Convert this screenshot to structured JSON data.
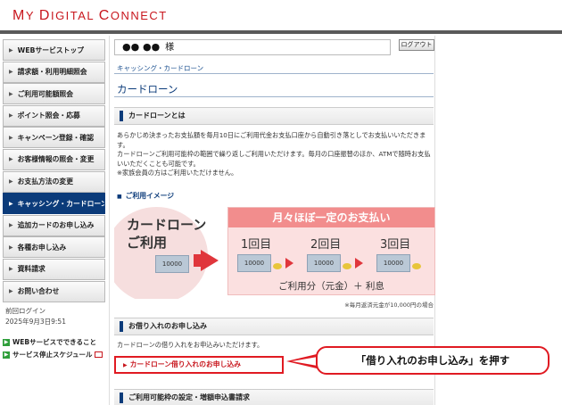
{
  "logo": {
    "text_a": "M",
    "text_b": "Y ",
    "text_c": "D",
    "text_d": "IGITAL ",
    "text_e": "C",
    "text_f": "ONNECT"
  },
  "header": {
    "greeting_name": "●● ●●",
    "greeting_suffix": "様",
    "logout": "ログアウト"
  },
  "sidebar": {
    "items": [
      {
        "label": "WEBサービストップ",
        "active": false
      },
      {
        "label": "請求額・利用明細照会",
        "active": false
      },
      {
        "label": "ご利用可能額照会",
        "active": false
      },
      {
        "label": "ポイント照会・応募",
        "active": false
      },
      {
        "label": "キャンペーン登録・確認",
        "active": false
      },
      {
        "label": "お客様情報の照会・変更",
        "active": false
      },
      {
        "label": "お支払方法の変更",
        "active": false
      },
      {
        "label": "キャッシング・カードローン",
        "active": true
      },
      {
        "label": "追加カードのお申し込み",
        "active": false
      },
      {
        "label": "各種お申し込み",
        "active": false
      },
      {
        "label": "資料請求",
        "active": false
      },
      {
        "label": "お問い合わせ",
        "active": false
      }
    ],
    "last_login_label": "前回ログイン",
    "last_login_value": "2025年9月3日9:51",
    "links": [
      {
        "label": "WEBサービスでできること"
      },
      {
        "label": "サービス停止スケジュール"
      }
    ]
  },
  "main": {
    "breadcrumb": "キャッシング・カードローン",
    "title": "カードローン",
    "section1_title": "カードローンとは",
    "section1_text_1": "あらかじめ決まったお支払額を毎月10日にご利用代金お支払口座から自動引き落としでお支払いいただきます。",
    "section1_text_2": "カードローンご利用可能枠の範囲で繰り返しご利用いただけます。毎月の口座振替のほか、ATMで随時お支払いいただくことも可能です。",
    "section1_text_3": "※家族会員の方はご利用いただけません。",
    "image_heading": "ご利用イメージ",
    "illus": {
      "left_line1": "カードローン",
      "left_line2": "ご利用",
      "panel_title": "月々ほぼ一定のお支払い",
      "period1": "1回目",
      "period2": "2回目",
      "period3": "3回目",
      "bill": "10000",
      "foot": "ご利用分（元金）＋ 利息"
    },
    "illus_note": "※毎月返済元金が10,000円の場合",
    "section2_title": "お借り入れのお申し込み",
    "section2_text": "カードローンの借り入れをお申込みいただけます。",
    "apply_link": "カードローン借り入れのお申し込み",
    "section3_title": "ご利用可能枠の設定・増額申込書請求"
  },
  "callout": "「借り入れのお申し込み」を押す",
  "colors": {
    "brand_red": "#c8171e",
    "nav_active": "#0b3b7a",
    "highlight": "#e01a22"
  }
}
